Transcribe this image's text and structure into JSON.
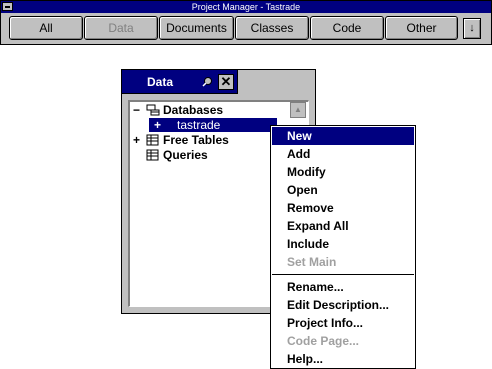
{
  "project_manager": {
    "title": "Project Manager - Tastrade",
    "tabs": [
      {
        "label": "All"
      },
      {
        "label": "Data"
      },
      {
        "label": "Documents"
      },
      {
        "label": "Classes"
      },
      {
        "label": "Code"
      },
      {
        "label": "Other"
      }
    ],
    "expand_glyph": "↓"
  },
  "data_panel": {
    "title": "Data",
    "close_glyph": "✕",
    "tree": [
      {
        "toggle": "−",
        "label": "Databases"
      },
      {
        "toggle": "+",
        "label": "tastrade"
      },
      {
        "toggle": "+",
        "label": "Free Tables"
      },
      {
        "toggle": "",
        "label": "Queries"
      }
    ]
  },
  "context_menu": {
    "group1": [
      "New",
      "Add",
      "Modify",
      "Open",
      "Remove",
      "Expand All",
      "Include",
      "Set Main"
    ],
    "group2": [
      "Rename...",
      "Edit Description...",
      "Project Info...",
      "Code Page...",
      "Help..."
    ]
  },
  "colors": {
    "selection": "#000080",
    "face": "#c0c0c0",
    "disabled": "#a0a0a0"
  }
}
